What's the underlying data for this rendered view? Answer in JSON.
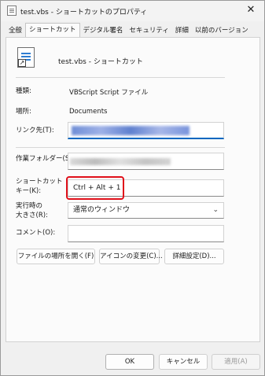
{
  "window": {
    "title": "test.vbs - ショートカットのプロパティ",
    "close_glyph": "✕"
  },
  "tabs": [
    {
      "label": "全般"
    },
    {
      "label": "ショートカット"
    },
    {
      "label": "デジタル署名"
    },
    {
      "label": "セキュリティ"
    },
    {
      "label": "詳細"
    },
    {
      "label": "以前のバージョン"
    }
  ],
  "active_tab": "ショートカット",
  "file": {
    "name": "test.vbs - ショートカット",
    "icon": "vbs-shortcut-icon"
  },
  "fields": {
    "type_label": "種類:",
    "type_value": "VBScript Script ファイル",
    "location_label": "場所:",
    "location_value": "Documents",
    "target_label": "リンク先(T):",
    "start_label": "作業フォルダー(S):",
    "hotkey_label_1": "ショートカット",
    "hotkey_label_2": "キー(K):",
    "hotkey_value": "Ctrl + Alt + 1",
    "run_label_1": "実行時の",
    "run_label_2": "大きさ(R):",
    "run_value": "通常のウィンドウ",
    "comment_label": "コメント(O):",
    "comment_value": ""
  },
  "buttons": {
    "open_location": "ファイルの場所を開く(F)",
    "change_icon": "アイコンの変更(C)...",
    "advanced": "詳細設定(D)...",
    "ok": "OK",
    "cancel": "キャンセル",
    "apply": "適用(A)"
  },
  "colors": {
    "highlight": "#e0101a",
    "accent": "#0067c0"
  }
}
